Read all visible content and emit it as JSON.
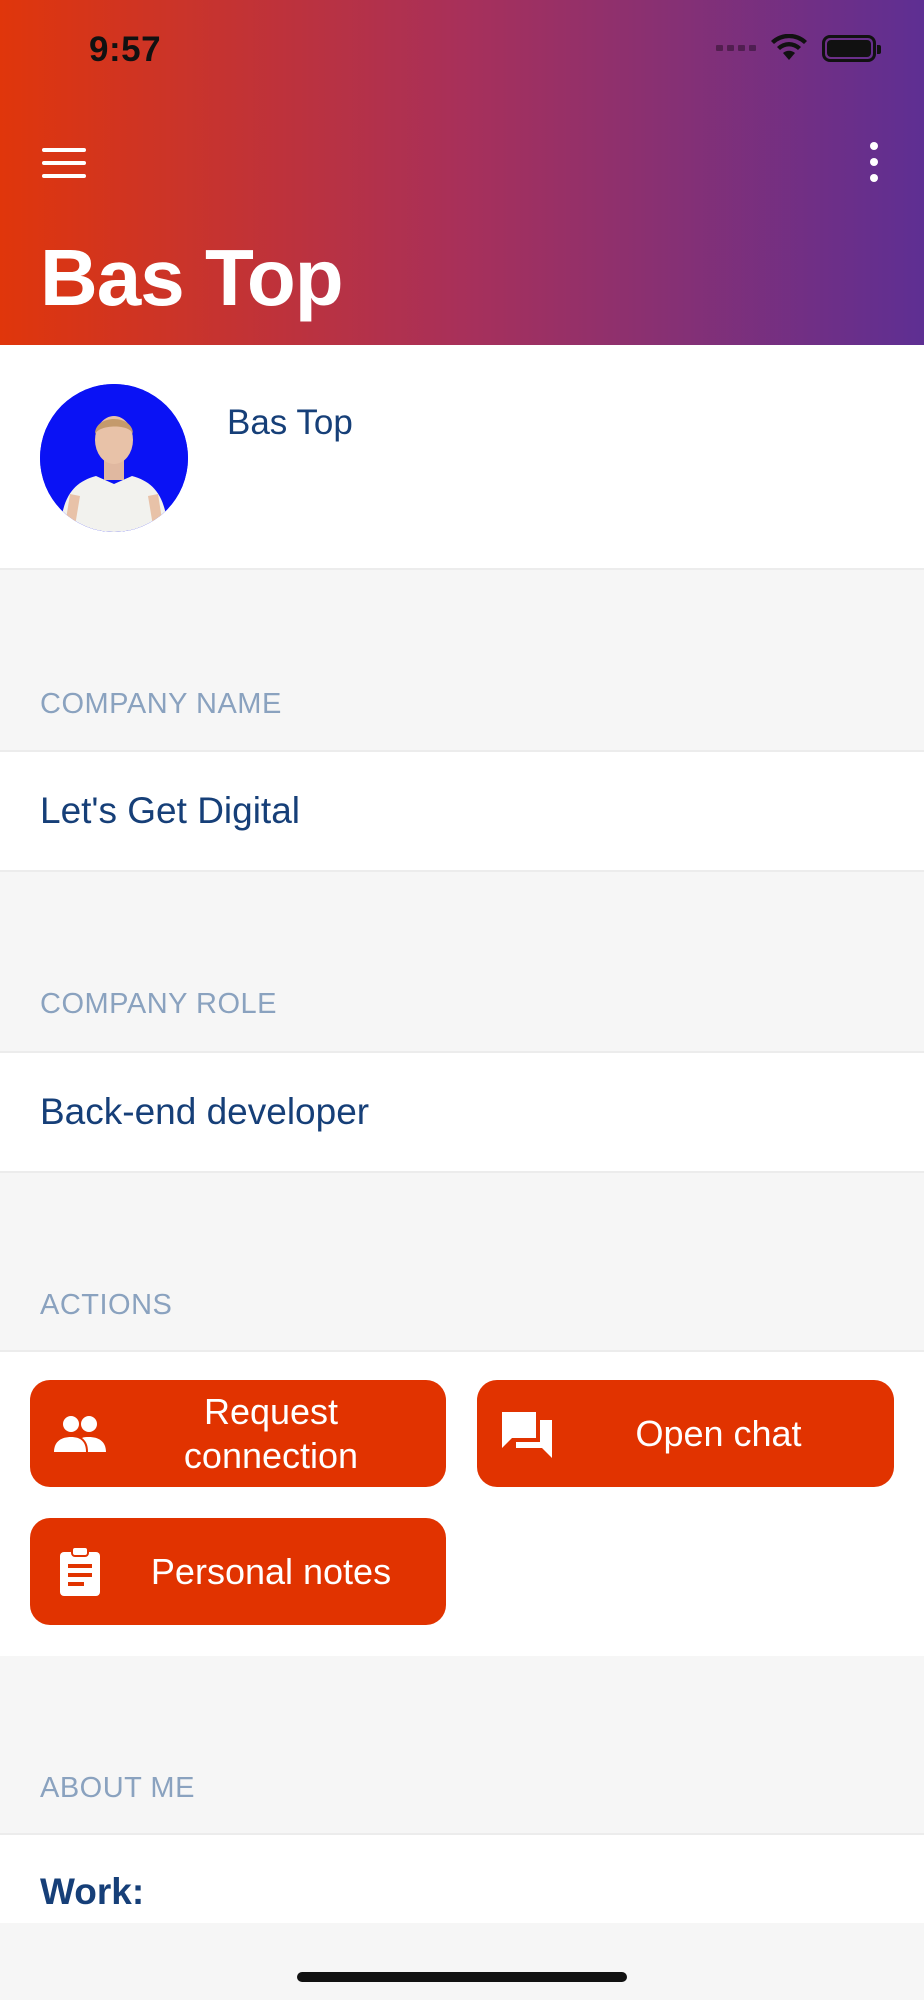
{
  "status_bar": {
    "time": "9:57"
  },
  "header": {
    "title": "Bas Top",
    "menu_icon": "hamburger-icon",
    "more_icon": "more-vertical-icon"
  },
  "profile": {
    "name": "Bas Top",
    "avatar_background": "#0a12f5"
  },
  "company_name": {
    "label": "COMPANY NAME",
    "value": "Let's Get Digital"
  },
  "company_role": {
    "label": "COMPANY ROLE",
    "value": "Back-end developer"
  },
  "actions": {
    "label": "ACTIONS",
    "request_connection": {
      "label_line1": "Request",
      "label_line2": "connection",
      "icon": "people-icon"
    },
    "open_chat": {
      "label": "Open chat",
      "icon": "chat-icon"
    },
    "personal_notes": {
      "label": "Personal notes",
      "icon": "clipboard-icon"
    }
  },
  "about": {
    "label": "ABOUT ME",
    "work_heading": "Work:"
  },
  "colors": {
    "accent": "#e13300",
    "text_primary": "#163f78",
    "section_label": "#8aa2bf",
    "gradient_start": "#e0360b",
    "gradient_end": "#5e2f93"
  }
}
